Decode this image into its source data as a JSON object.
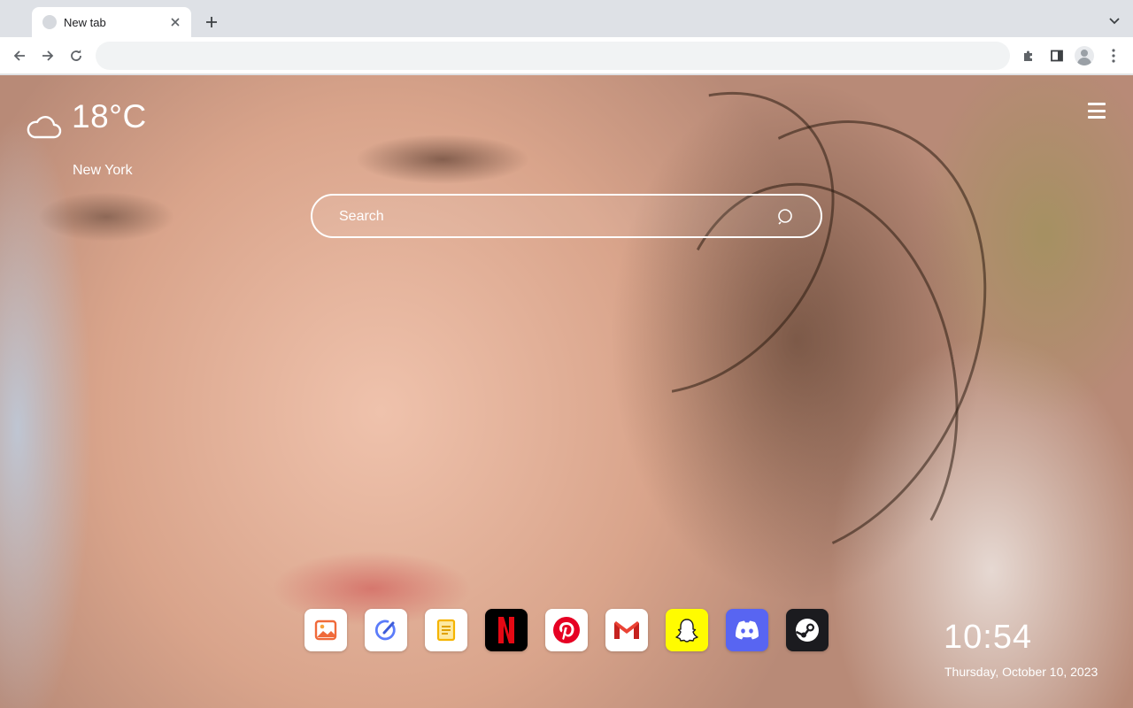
{
  "browser": {
    "tab": {
      "title": "New tab"
    },
    "omnibox": {
      "value": "",
      "placeholder": ""
    },
    "icons": {
      "back": "arrow-left-icon",
      "forward": "arrow-right-icon",
      "reload": "reload-icon",
      "extensions": "puzzle-icon",
      "side_panel": "side-panel-icon",
      "profile": "avatar-icon",
      "menu": "kebab-menu-icon"
    }
  },
  "weather": {
    "temperature": "18°C",
    "city": "New York",
    "icon": "cloud-icon"
  },
  "search": {
    "placeholder": "Search"
  },
  "dock": {
    "apps": [
      {
        "name": "photos",
        "bg": "#ffffff",
        "accent": "#f06a3a"
      },
      {
        "name": "tasks",
        "bg": "#ffffff",
        "accent": "#5b7cfa"
      },
      {
        "name": "notes",
        "bg": "#ffffff",
        "accent": "#f5b400"
      },
      {
        "name": "netflix",
        "bg": "#000000",
        "accent": "#e50914"
      },
      {
        "name": "pinterest",
        "bg": "#ffffff",
        "accent": "#e60023"
      },
      {
        "name": "gmail",
        "bg": "#ffffff",
        "accent": "#ea4335"
      },
      {
        "name": "snapchat",
        "bg": "#fffc00",
        "accent": "#ffffff"
      },
      {
        "name": "discord",
        "bg": "#5865f2",
        "accent": "#ffffff"
      },
      {
        "name": "steam",
        "bg": "#1b1b1f",
        "accent": "#ffffff"
      }
    ]
  },
  "clock": {
    "time": "10:54",
    "date": "Thursday, October 10, 2023"
  }
}
